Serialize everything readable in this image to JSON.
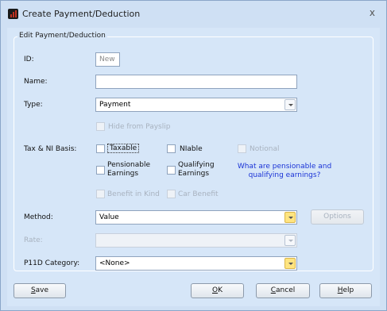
{
  "window": {
    "title": "Create Payment/Deduction",
    "close_glyph": "x"
  },
  "group": {
    "legend": "Edit Payment/Deduction"
  },
  "fields": {
    "id": {
      "label": "ID:",
      "value": "New"
    },
    "name": {
      "label": "Name:",
      "value": ""
    },
    "type": {
      "label": "Type:",
      "value": "Payment"
    },
    "hide_from_payslip": {
      "label": "Hide from Payslip",
      "checked": false,
      "enabled": false
    },
    "tax_ni": {
      "label": "Tax & NI Basis:",
      "taxable": {
        "label": "Taxable",
        "checked": false
      },
      "niable": {
        "label": "NIable",
        "checked": false
      },
      "notional": {
        "label": "Notional",
        "checked": false,
        "enabled": false
      },
      "pensionable": {
        "label_line1": "Pensionable",
        "label_line2": "Earnings",
        "checked": false
      },
      "qualifying": {
        "label_line1": "Qualifying",
        "label_line2": "Earnings",
        "checked": false
      },
      "help_link_line1": "What are pensionable and",
      "help_link_line2": "qualifying earnings?",
      "benefit_in_kind": {
        "label": "Benefit in Kind",
        "checked": false,
        "enabled": false
      },
      "car_benefit": {
        "label": "Car Benefit",
        "checked": false,
        "enabled": false
      }
    },
    "method": {
      "label": "Method:",
      "value": "Value",
      "options_button": "Options"
    },
    "rate": {
      "label": "Rate:",
      "value": "",
      "enabled": false
    },
    "p11d": {
      "label": "P11D Category:",
      "value": "<None>"
    }
  },
  "buttons": {
    "save": {
      "mnemonic": "S",
      "rest": "ave"
    },
    "ok": {
      "mnemonic": "O",
      "rest": "K"
    },
    "cancel": {
      "mnemonic": "C",
      "rest": "ancel"
    },
    "help": {
      "mnemonic": "H",
      "rest": "elp"
    }
  },
  "colors": {
    "window_bg": "#cfe0f4",
    "link": "#1a33d6",
    "combo_hot": "#ffe480"
  }
}
